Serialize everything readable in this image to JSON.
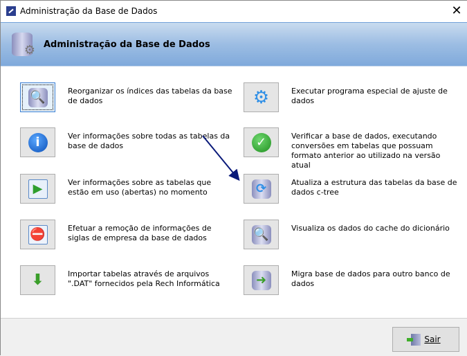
{
  "window": {
    "title": "Administração da Base de Dados",
    "close_label": "✕"
  },
  "header": {
    "title": "Administração da Base de Dados",
    "icon": "database-gear-icon"
  },
  "items_left": [
    {
      "label": "Reorganizar os índices das tabelas da base de dados",
      "icon": "database-search-icon"
    },
    {
      "label": "Ver informações sobre todas as tabelas da base de dados",
      "icon": "info-icon"
    },
    {
      "label": "Ver informações sobre as tabelas que estão em uso (abertas) no momento",
      "icon": "table-play-icon"
    },
    {
      "label": "Efetuar a remoção de informações de siglas de empresa da base de dados",
      "icon": "calendar-forbidden-icon"
    },
    {
      "label": "Importar tabelas através de arquivos \".DAT\" fornecidos pela Rech Informática",
      "icon": "download-tray-icon"
    }
  ],
  "items_right": [
    {
      "label": "Executar programa especial de ajuste de dados",
      "icon": "gear-icon"
    },
    {
      "label": "Verificar a base de dados, executando conversões em tabelas que possuam formato anterior ao utilizado na versão atual",
      "icon": "check-icon"
    },
    {
      "label": "Atualiza a estrutura das tabelas da base de dados c-tree",
      "icon": "database-refresh-icon"
    },
    {
      "label": "Visualiza os dados do cache do dicionário",
      "icon": "database-search-icon"
    },
    {
      "label": "Migra base de dados para outro banco de dados",
      "icon": "database-migrate-icon"
    }
  ],
  "footer": {
    "exit_label": "Sair"
  }
}
